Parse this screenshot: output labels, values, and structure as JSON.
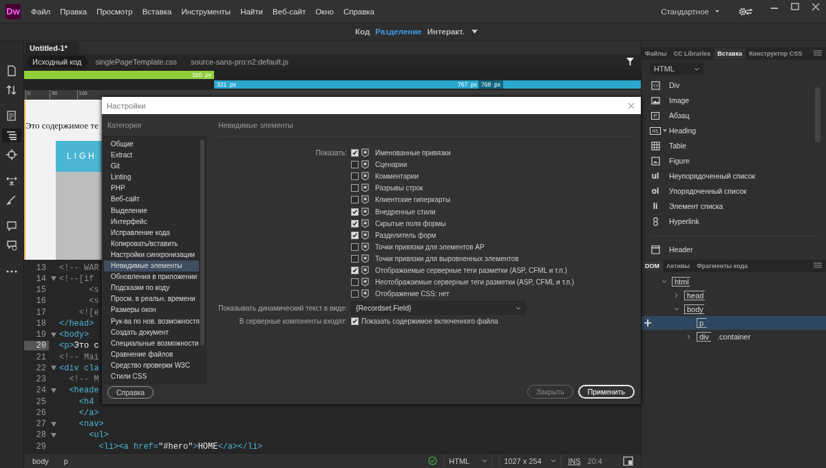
{
  "app_logo": "Dw",
  "menu": [
    "Файл",
    "Правка",
    "Просмотр",
    "Вставка",
    "Инструменты",
    "Найти",
    "Веб-сайт",
    "Окно",
    "Справка"
  ],
  "workspace": "Стандартное",
  "views": [
    {
      "label": "Код",
      "selected": false
    },
    {
      "label": "Разделение",
      "selected": true
    },
    {
      "label": "Интеракт.",
      "selected": false
    }
  ],
  "document_tab": "Untitled-1*",
  "related_files": [
    {
      "label": "Исходный код",
      "selected": true
    },
    {
      "label": "singlePageTemplate.css",
      "selected": false
    },
    {
      "label": "source-sans-pro:n2:default.js",
      "selected": false
    }
  ],
  "media_queries": [
    {
      "kind": "max",
      "labels": [
        {
          "value": "320",
          "unit": "px"
        }
      ]
    },
    {
      "kind": "range",
      "labels": [
        {
          "value": "321",
          "unit": "px"
        },
        {
          "value": "767",
          "unit": "px"
        },
        {
          "value": "768",
          "unit": "px"
        }
      ]
    }
  ],
  "ruler": [
    "0",
    "50",
    "100"
  ],
  "design_view": {
    "text": "Это содержимое те",
    "logo": "LIGH"
  },
  "code_lines": [
    {
      "number": "13",
      "fold": false,
      "current": false,
      "tokens": [
        {
          "kind": "comment",
          "text": "<!-- WAR"
        }
      ]
    },
    {
      "number": "14",
      "fold": true,
      "current": false,
      "tokens": [
        {
          "kind": "comment",
          "text": "<!--[if"
        }
      ]
    },
    {
      "number": "15",
      "fold": false,
      "current": false,
      "tokens": [
        {
          "kind": "comment",
          "text": "      <s"
        }
      ]
    },
    {
      "number": "16",
      "fold": false,
      "current": false,
      "tokens": [
        {
          "kind": "comment",
          "text": "      <s"
        }
      ]
    },
    {
      "number": "17",
      "fold": false,
      "current": false,
      "tokens": [
        {
          "kind": "comment",
          "text": "    <![e"
        }
      ]
    },
    {
      "number": "18",
      "fold": false,
      "current": false,
      "tokens": [
        {
          "kind": "tag",
          "text": "</head>"
        }
      ]
    },
    {
      "number": "19",
      "fold": true,
      "current": false,
      "tokens": [
        {
          "kind": "tag",
          "text": "<body>"
        }
      ]
    },
    {
      "number": "20",
      "fold": false,
      "current": true,
      "tokens": [
        {
          "kind": "tag",
          "text": "<p>"
        },
        {
          "kind": "text",
          "text": "Это c"
        }
      ]
    },
    {
      "number": "21",
      "fold": false,
      "current": false,
      "tokens": [
        {
          "kind": "comment",
          "text": "<!-- Mai"
        }
      ]
    },
    {
      "number": "22",
      "fold": true,
      "current": false,
      "tokens": [
        {
          "kind": "tag",
          "text": "<div cla"
        }
      ]
    },
    {
      "number": "23",
      "fold": false,
      "current": false,
      "tokens": [
        {
          "kind": "comment",
          "text": "  <!-- M"
        }
      ]
    },
    {
      "number": "24",
      "fold": true,
      "current": false,
      "tokens": [
        {
          "kind": "tag",
          "text": "  <heade"
        }
      ]
    },
    {
      "number": "25",
      "fold": false,
      "current": false,
      "tokens": [
        {
          "kind": "tag",
          "text": "    <h4"
        }
      ]
    },
    {
      "number": "26",
      "fold": false,
      "current": false,
      "tokens": [
        {
          "kind": "tag",
          "text": "    </a>"
        }
      ]
    },
    {
      "number": "27",
      "fold": true,
      "current": false,
      "tokens": [
        {
          "kind": "tag",
          "text": "    <nav>"
        }
      ]
    },
    {
      "number": "28",
      "fold": true,
      "current": false,
      "tokens": [
        {
          "kind": "tag",
          "text": "      <ul>"
        }
      ]
    },
    {
      "number": "29",
      "fold": false,
      "current": false,
      "tokens": [
        {
          "kind": "tag",
          "text": "        <li><a href="
        },
        {
          "kind": "string",
          "text": "\"#hero\""
        },
        {
          "kind": "tag",
          "text": ">"
        },
        {
          "kind": "text",
          "text": "HOME"
        },
        {
          "kind": "tag",
          "text": "</a></li>"
        }
      ]
    }
  ],
  "status_bar": {
    "breadcrumbs": [
      "body",
      "p"
    ],
    "valid": true,
    "language": "HTML",
    "size": "1027 x 254",
    "mode": "INS",
    "position": "20:4"
  },
  "panel": {
    "tabs": [
      {
        "label": "Файлы",
        "selected": false
      },
      {
        "label": "CC Libraries",
        "selected": false
      },
      {
        "label": "Вставка",
        "selected": true
      },
      {
        "label": "Конструктор CSS",
        "selected": false
      }
    ],
    "filter": "HTML",
    "items": [
      {
        "kind": "div",
        "label": "Div"
      },
      {
        "kind": "image",
        "label": "Image"
      },
      {
        "kind": "tag",
        "glyph": "P",
        "label": "Абзац"
      },
      {
        "kind": "tag",
        "glyph": "H1",
        "label": "Heading",
        "menu": true
      },
      {
        "kind": "table",
        "label": "Table"
      },
      {
        "kind": "figure",
        "label": "Figure"
      },
      {
        "kind": "letters",
        "glyph": "ul",
        "label": "Неупорядоченный список"
      },
      {
        "kind": "letters",
        "glyph": "ol",
        "label": "Упорядоченный список"
      },
      {
        "kind": "letters",
        "glyph": "li",
        "label": "Элемент списка"
      },
      {
        "kind": "link",
        "label": "Hyperlink"
      },
      {
        "kind": "header",
        "label": "Header",
        "separated": true
      }
    ],
    "dom_tabs": [
      {
        "label": "DOM",
        "selected": true
      },
      {
        "label": "Активы",
        "selected": false
      },
      {
        "label": "Фрагменты кода",
        "selected": false
      }
    ],
    "dom_tree": [
      {
        "tag": "html",
        "expanded": true,
        "selected": false,
        "children": [
          {
            "tag": "head",
            "expanded": false,
            "selected": false
          },
          {
            "tag": "body",
            "expanded": true,
            "selected": false,
            "children": [
              {
                "tag": "p",
                "selected": true
              },
              {
                "tag": "div",
                "class": ".container",
                "expanded": false,
                "selected": false
              }
            ]
          }
        ]
      }
    ]
  },
  "dialog": {
    "title": "Настройки",
    "category_label": "Категория",
    "categories": [
      {
        "label": "Общие",
        "selected": false
      },
      {
        "label": "Extract",
        "selected": false
      },
      {
        "label": "Git",
        "selected": false
      },
      {
        "label": "Linting",
        "selected": false
      },
      {
        "label": "PHP",
        "selected": false
      },
      {
        "label": "Веб-сайт",
        "selected": false
      },
      {
        "label": "Выделение",
        "selected": false
      },
      {
        "label": "Интерфейс",
        "selected": false
      },
      {
        "label": "Исправление кода",
        "selected": false
      },
      {
        "label": "Копировать/вставить",
        "selected": false
      },
      {
        "label": "Настройки синхронизации",
        "selected": false
      },
      {
        "label": "Невидимые элементы",
        "selected": true
      },
      {
        "label": "Обновления в приложении",
        "selected": false
      },
      {
        "label": "Подсказки по коду",
        "selected": false
      },
      {
        "label": "Просм. в реальн. времени",
        "selected": false
      },
      {
        "label": "Размеры окон",
        "selected": false
      },
      {
        "label": "Рук-ва по нов. возможностя",
        "selected": false
      },
      {
        "label": "Создать документ",
        "selected": false
      },
      {
        "label": "Специальные возможности",
        "selected": false
      },
      {
        "label": "Сравнение файлов",
        "selected": false
      },
      {
        "label": "Средство проверки W3C",
        "selected": false
      },
      {
        "label": "Стили CSS",
        "selected": false
      }
    ],
    "section_title": "Невидимые элементы",
    "show_label": "Показать:",
    "options": [
      {
        "label": "Именованные привязки",
        "checked": true
      },
      {
        "label": "Сценарии",
        "checked": false
      },
      {
        "label": "Комментарии",
        "checked": false
      },
      {
        "label": "Разрывы строк",
        "checked": false
      },
      {
        "label": "Клиентские гиперкарты",
        "checked": false
      },
      {
        "label": "Внедренные стили",
        "checked": true
      },
      {
        "label": "Скрытые поля формы",
        "checked": true
      },
      {
        "label": "Разделитель форм",
        "checked": true
      },
      {
        "label": "Точки привязки для элементов AP",
        "checked": false
      },
      {
        "label": "Точки привязки для выровненных элементов",
        "checked": false
      },
      {
        "label": "Отображаемые серверные теги разметки (ASP, CFML и т.п.)",
        "checked": true
      },
      {
        "label": "Неотображаемые серверные теги разметки (ASP, CFML и т.п.)",
        "checked": false
      },
      {
        "label": "Отображение CSS: нет",
        "checked": false
      }
    ],
    "dynamic_label": "Показывать динамический текст в виде:",
    "dynamic_value": "{Recordset.Field}",
    "server_label": "В серверные компоненты входят:",
    "server_option": {
      "label": "Показать содержимое включенного файла",
      "checked": true
    },
    "help": "Справка",
    "close": "Закрыть",
    "apply": "Применить"
  }
}
